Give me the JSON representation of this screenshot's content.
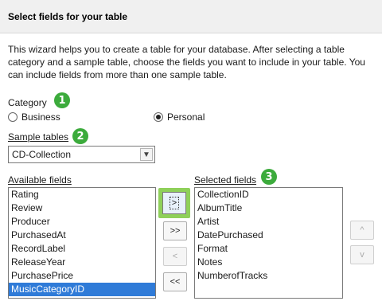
{
  "header": {
    "title": "Select fields for your table"
  },
  "description": "This wizard helps you to create a table for your database. After selecting a table category and a sample table, choose the fields you want to include in your table. You can include fields from more than one sample table.",
  "category": {
    "label": "Category",
    "badge": "1",
    "options": [
      {
        "label": "Business",
        "checked": false
      },
      {
        "label": "Personal",
        "checked": true
      }
    ]
  },
  "sample_tables": {
    "label": "Sample tables",
    "badge": "2",
    "value": "CD-Collection"
  },
  "available_fields": {
    "label": "Available fields",
    "items": [
      "Rating",
      "Review",
      "Producer",
      "PurchasedAt",
      "RecordLabel",
      "ReleaseYear",
      "PurchasePrice",
      "MusicCategoryID"
    ],
    "selected_index": 7
  },
  "selected_fields": {
    "label": "Selected fields",
    "badge": "3",
    "items": [
      "CollectionID",
      "AlbumTitle",
      "Artist",
      "DatePurchased",
      "Format",
      "Notes",
      "NumberofTracks"
    ]
  },
  "move_buttons": {
    "add_one": ">",
    "add_all": ">>",
    "remove_one": "<",
    "remove_all": "<<"
  },
  "order_buttons": {
    "up": "^",
    "down": "v"
  },
  "colors": {
    "badge": "#3cab3c",
    "highlight": "#8fd05a",
    "selection": "#2f7bd8"
  }
}
